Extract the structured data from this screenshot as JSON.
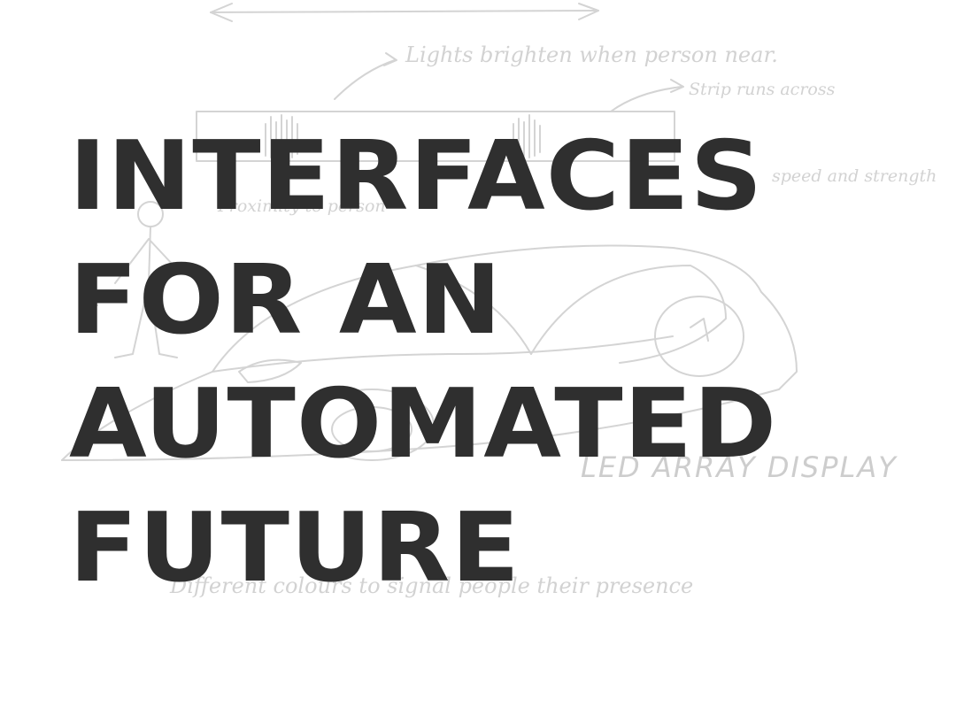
{
  "headline": {
    "lines": [
      "INTERFACES",
      "FOR AN",
      "AUTOMATED",
      "FUTURE"
    ]
  },
  "sketch_notes": {
    "lights": "Lights brighten when person near.",
    "strip": "Strip runs across",
    "speed": "speed and strength",
    "proximity": "Proximity to person",
    "led": "LED ARRAY DISPLAY",
    "colours": "Different colours to signal people their presence"
  },
  "colors": {
    "headline": "#2f2f2f",
    "sketch": "#d4d4d4",
    "background": "#ffffff"
  }
}
